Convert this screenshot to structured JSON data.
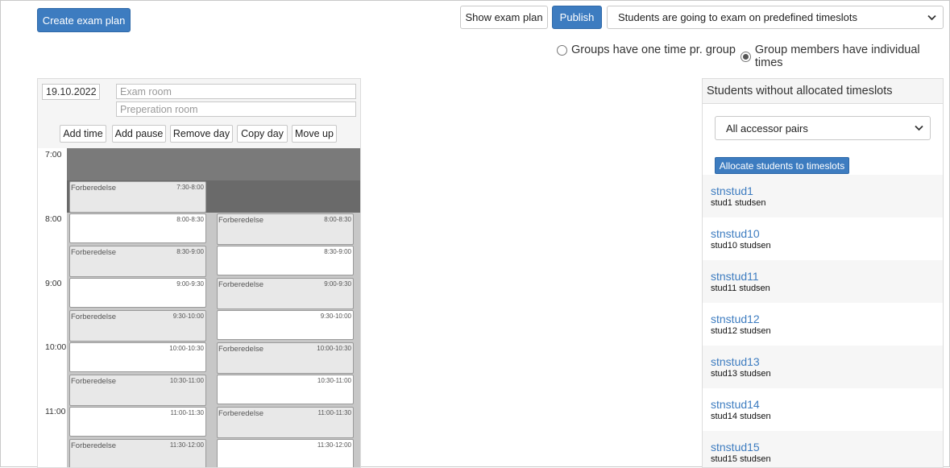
{
  "toolbar": {
    "create_label": "Create exam plan",
    "show_label": "Show exam plan",
    "publish_label": "Publish",
    "mode_select": "Students are going to exam on predefined timeslots"
  },
  "radios": [
    {
      "label": "Groups have one time pr. group",
      "checked": false
    },
    {
      "label": "Group members have individual times",
      "checked": true
    }
  ],
  "day": {
    "date": "19.10.2022",
    "exam_room_placeholder": "Exam room",
    "prep_room_placeholder": "Preperation room",
    "buttons": [
      "Add time",
      "Add pause",
      "Remove day",
      "Copy day",
      "Move up"
    ],
    "hours": [
      "7:00",
      "8:00",
      "9:00",
      "10:00",
      "11:00"
    ],
    "prep_title": "Forberedelse",
    "column_a": [
      "7:30-8:00",
      "8:00-8:30",
      "8:30-9:00",
      "9:00-9:30",
      "9:30-10:00",
      "10:00-10:30",
      "10:30-11:00",
      "11:00-11:30",
      "11:30-12:00"
    ],
    "column_b": [
      "8:00-8:30",
      "8:30-9:00",
      "9:00-9:30",
      "9:30-10:00",
      "10:00-10:30",
      "10:30-11:00",
      "11:00-11:30",
      "11:30-12:00"
    ]
  },
  "unallocated": {
    "title": "Students without allocated timeslots",
    "filter": "All accessor pairs",
    "allocate_label": "Allocate students to timeslots",
    "students": [
      {
        "username": "stnstud1",
        "name": "stud1 studsen"
      },
      {
        "username": "stnstud10",
        "name": "stud10 studsen"
      },
      {
        "username": "stnstud11",
        "name": "stud11 studsen"
      },
      {
        "username": "stnstud12",
        "name": "stud12 studsen"
      },
      {
        "username": "stnstud13",
        "name": "stud13 studsen"
      },
      {
        "username": "stnstud14",
        "name": "stud14 studsen"
      },
      {
        "username": "stnstud15",
        "name": "stud15 studsen"
      }
    ]
  },
  "icons": {
    "select_chevron": "chevron-down-icon",
    "radio": "radio-icon"
  },
  "colors": {
    "primary": "#3d7cc0",
    "band_dark": "#7a7a7a",
    "band_darker": "#6a6a6a",
    "prep_slot": "#e8e8e8"
  }
}
